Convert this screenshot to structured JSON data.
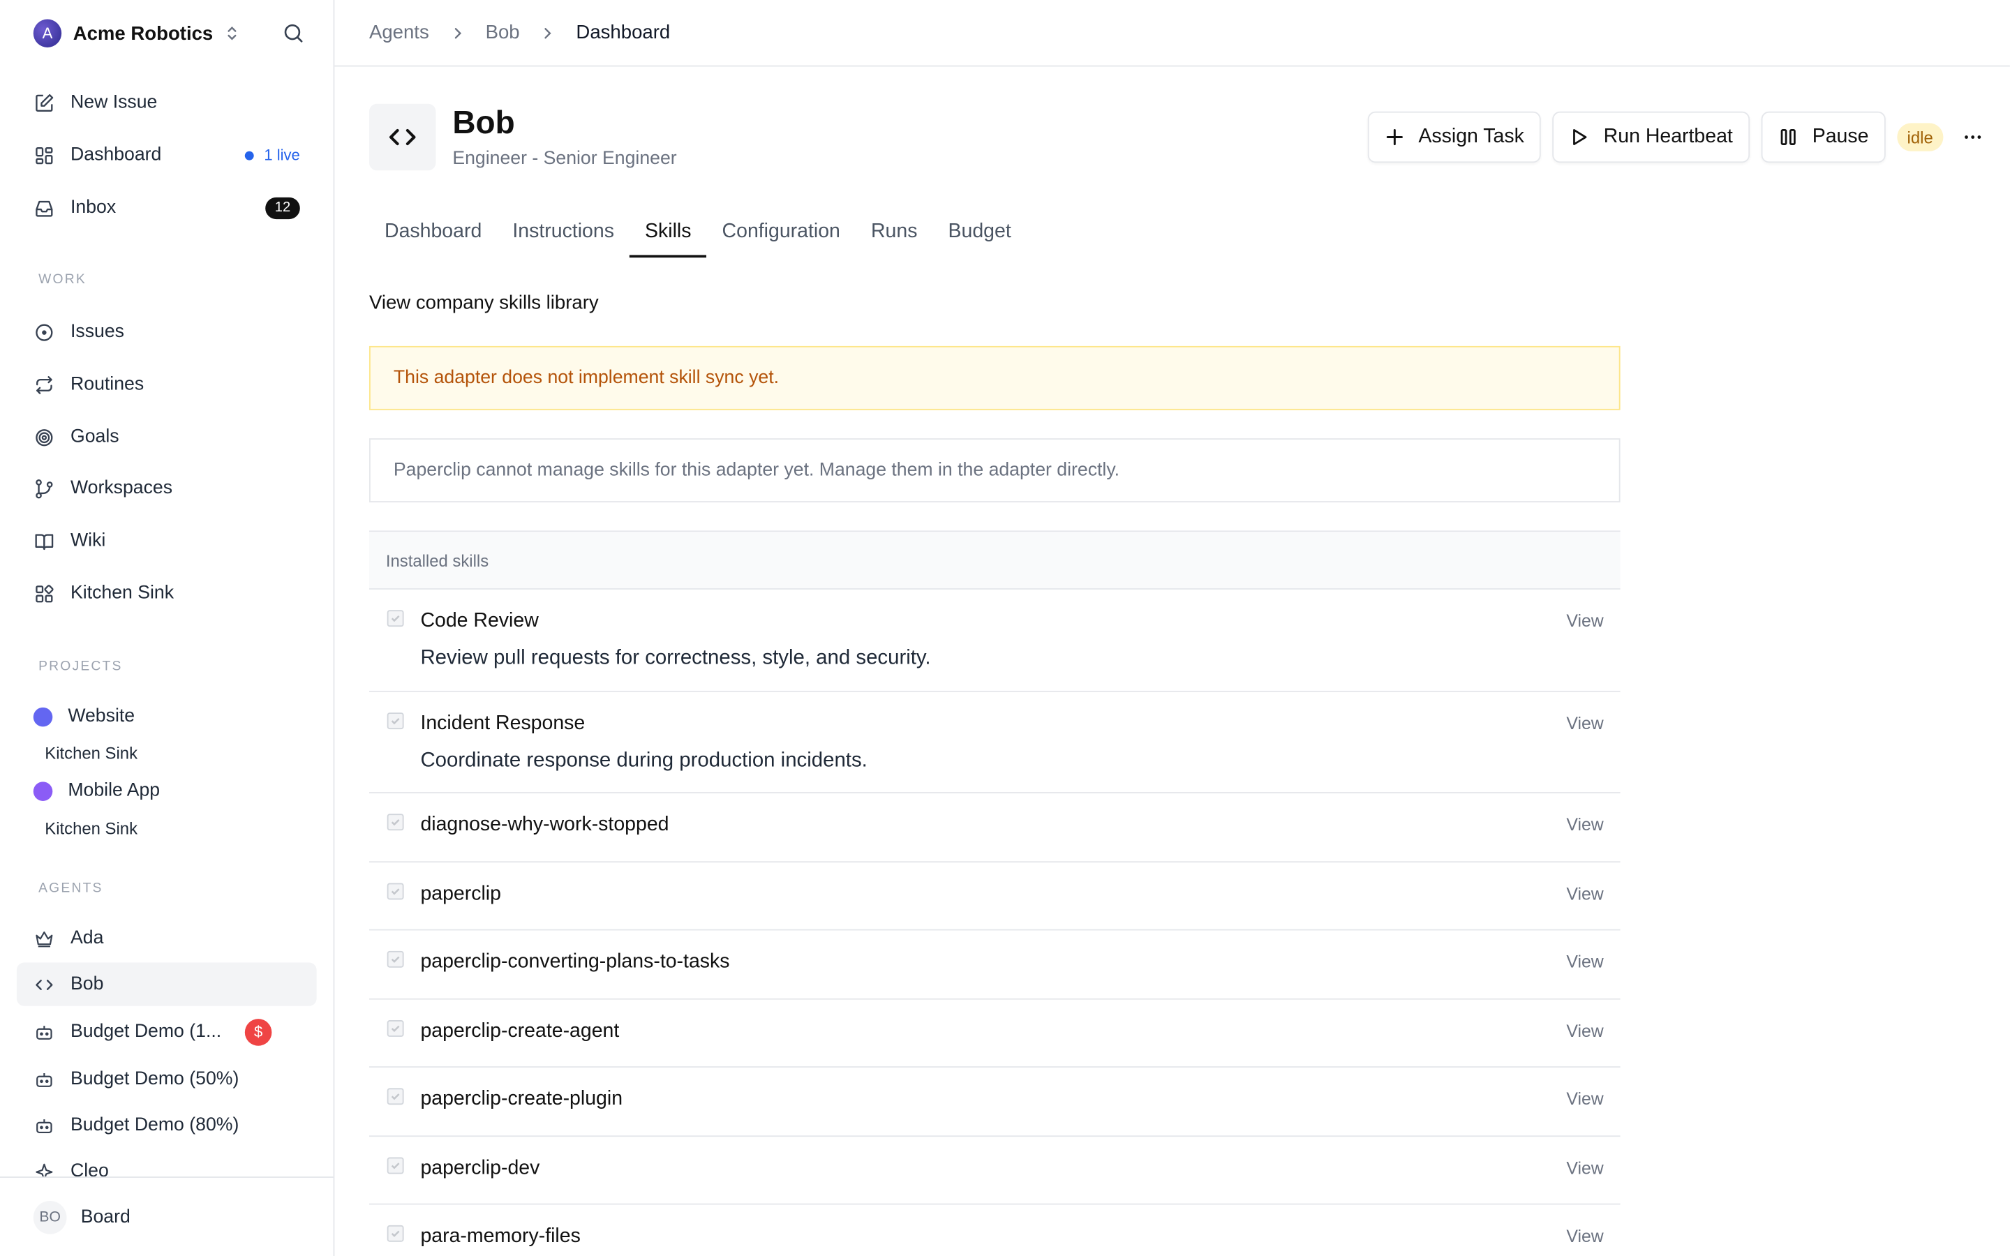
{
  "company": {
    "name": "Acme Robotics",
    "logo_letter": "A"
  },
  "sidebar": {
    "top_items": [
      {
        "label": "New Issue"
      },
      {
        "label": "Dashboard",
        "live": "1 live"
      },
      {
        "label": "Inbox",
        "count": "12"
      }
    ],
    "work_label": "WORK",
    "work_items": [
      {
        "label": "Issues"
      },
      {
        "label": "Routines"
      },
      {
        "label": "Goals"
      },
      {
        "label": "Workspaces"
      },
      {
        "label": "Wiki"
      },
      {
        "label": "Kitchen Sink"
      }
    ],
    "projects_label": "PROJECTS",
    "projects": [
      {
        "label": "Website",
        "color": "#6366f1",
        "sub": "Kitchen Sink"
      },
      {
        "label": "Mobile App",
        "color": "#8b5cf6",
        "sub": "Kitchen Sink"
      }
    ],
    "agents_label": "AGENTS",
    "agents": [
      {
        "label": "Ada"
      },
      {
        "label": "Bob"
      },
      {
        "label": "Budget Demo (1...",
        "badge": "$"
      },
      {
        "label": "Budget Demo (50%)"
      },
      {
        "label": "Budget Demo (80%)"
      },
      {
        "label": "Cleo"
      }
    ],
    "footer": {
      "initials": "BO",
      "label": "Board"
    }
  },
  "breadcrumb": [
    "Agents",
    "Bob",
    "Dashboard"
  ],
  "agent": {
    "name": "Bob",
    "role": "Engineer - Senior Engineer",
    "status": "idle"
  },
  "actions": {
    "assign": "Assign Task",
    "heartbeat": "Run Heartbeat",
    "pause": "Pause",
    "more": "···"
  },
  "tabs": [
    "Dashboard",
    "Instructions",
    "Skills",
    "Configuration",
    "Runs",
    "Budget"
  ],
  "active_tab": "Skills",
  "skills_page": {
    "library_link": "View company skills library",
    "warning": "This adapter does not implement skill sync yet.",
    "info": "Paperclip cannot manage skills for this adapter yet. Manage them in the adapter directly.",
    "installed_label": "Installed skills",
    "view_label": "View",
    "skills": [
      {
        "name": "Code Review",
        "desc": "Review pull requests for correctness, style, and security."
      },
      {
        "name": "Incident Response",
        "desc": "Coordinate response during production incidents."
      },
      {
        "name": "diagnose-why-work-stopped"
      },
      {
        "name": "paperclip"
      },
      {
        "name": "paperclip-converting-plans-to-tasks"
      },
      {
        "name": "paperclip-create-agent"
      },
      {
        "name": "paperclip-create-plugin"
      },
      {
        "name": "paperclip-dev"
      },
      {
        "name": "para-memory-files"
      }
    ]
  }
}
